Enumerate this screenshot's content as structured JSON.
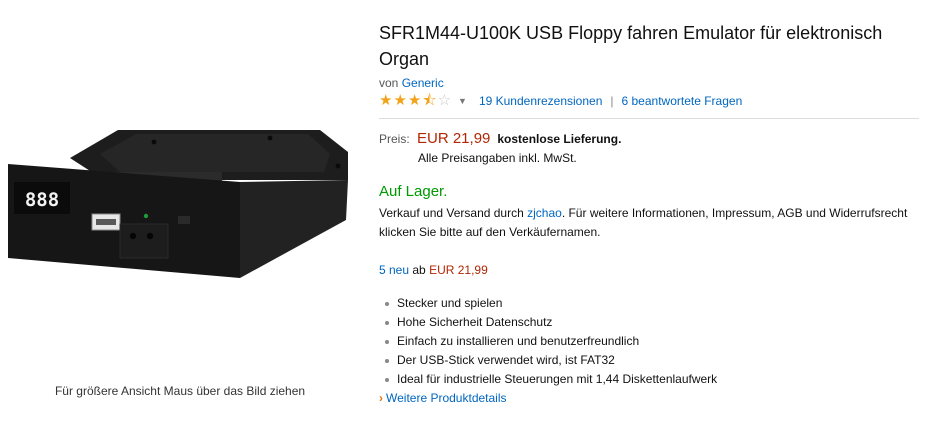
{
  "product": {
    "title": "SFR1M44-U100K USB Floppy fahren Emulator für elektronisch Organ",
    "by_prefix": "von",
    "brand": "Generic",
    "rating": 3.5,
    "rating_max": 5,
    "reviews_link": "19 Kundenrezensionen",
    "separator": "|",
    "questions_link": "6 beantwortete Fragen"
  },
  "image": {
    "hint": "Für größere Ansicht Maus über das Bild ziehen",
    "display_text": "888"
  },
  "price": {
    "label": "Preis:",
    "amount": "EUR 21,99",
    "shipping": "kostenlose Lieferung.",
    "vat_note": "Alle Preisangaben inkl. MwSt."
  },
  "availability": {
    "status": "Auf Lager.",
    "seller_prefix": "Verkauf und Versand durch",
    "seller": "zjchao",
    "seller_suffix": ". Für weitere Informationen, Impressum, AGB und Widerrufsrecht klicken Sie bitte auf den Verkäufernamen."
  },
  "offers": {
    "count_link": "5 neu",
    "from": "ab",
    "price": "EUR 21,99"
  },
  "features": [
    "Stecker und spielen",
    "Hohe Sicherheit Datenschutz",
    "Einfach zu installieren und benutzerfreundlich",
    "Der USB-Stick verwendet wird, ist FAT32",
    "Ideal für industrielle Steuerungen mit 1,44 Diskettenlaufwerk"
  ],
  "more_details": "Weitere Produktdetails",
  "colors": {
    "link": "#0066c0",
    "price": "#b12704",
    "in_stock": "#009900",
    "star": "#f2a31c"
  }
}
